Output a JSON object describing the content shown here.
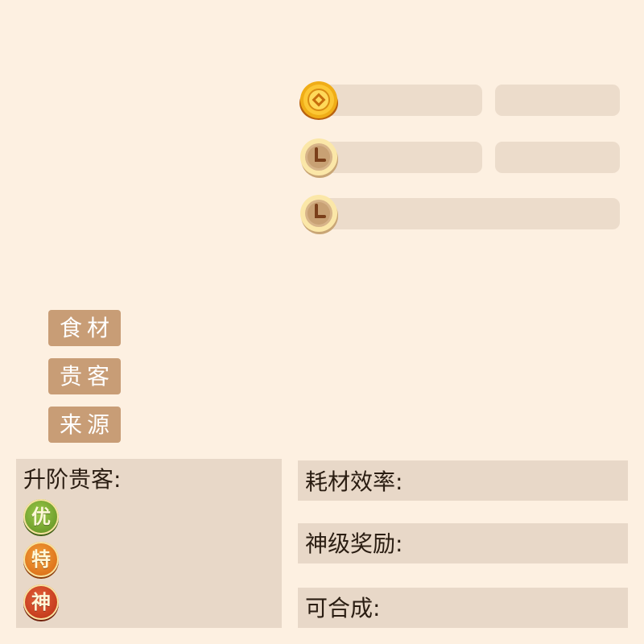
{
  "stats": {
    "coin_icon": "coin-icon",
    "clock_icon": "clock-icon"
  },
  "tags": {
    "ingredients": "食材",
    "guests": "贵客",
    "source": "来源"
  },
  "left_panel": {
    "title": "升阶贵客:",
    "badges": [
      {
        "label": "优",
        "color": "#7fae3a"
      },
      {
        "label": "特",
        "color": "#e07a1e"
      },
      {
        "label": "神",
        "color": "#c9401f"
      }
    ]
  },
  "right_panel": {
    "efficiency_label": "耗材效率:",
    "god_reward_label": "神级奖励:",
    "craftable_label": "可合成:"
  },
  "colors": {
    "background": "#fdf0e1",
    "bar": "#ecdccb",
    "tag": "#c89d76",
    "panel": "#e8d8c8"
  }
}
